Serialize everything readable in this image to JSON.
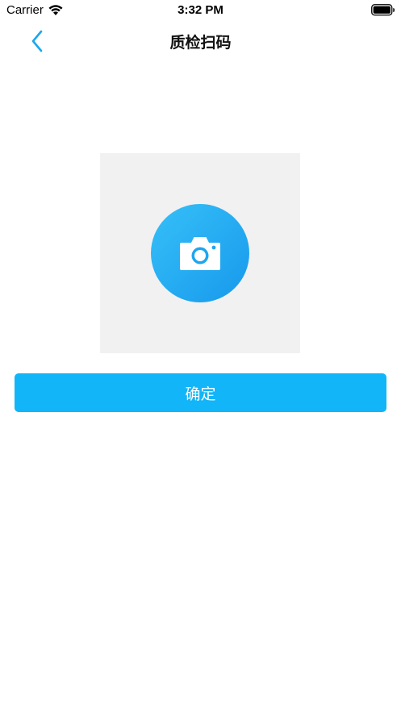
{
  "status_bar": {
    "carrier": "Carrier",
    "time": "3:32 PM",
    "wifi_icon": "wifi-icon",
    "battery_icon": "battery-icon"
  },
  "nav": {
    "back_icon": "chevron-left-icon",
    "title": "质检扫码"
  },
  "photo": {
    "icon": "camera-icon"
  },
  "confirm_label": "确定",
  "colors": {
    "accent": "#12b5f8",
    "camera_circle_top": "#36c0f8",
    "camera_circle_bottom": "#1799ec",
    "photo_bg": "#f1f1f1",
    "back_chevron": "#1aa7ec"
  }
}
